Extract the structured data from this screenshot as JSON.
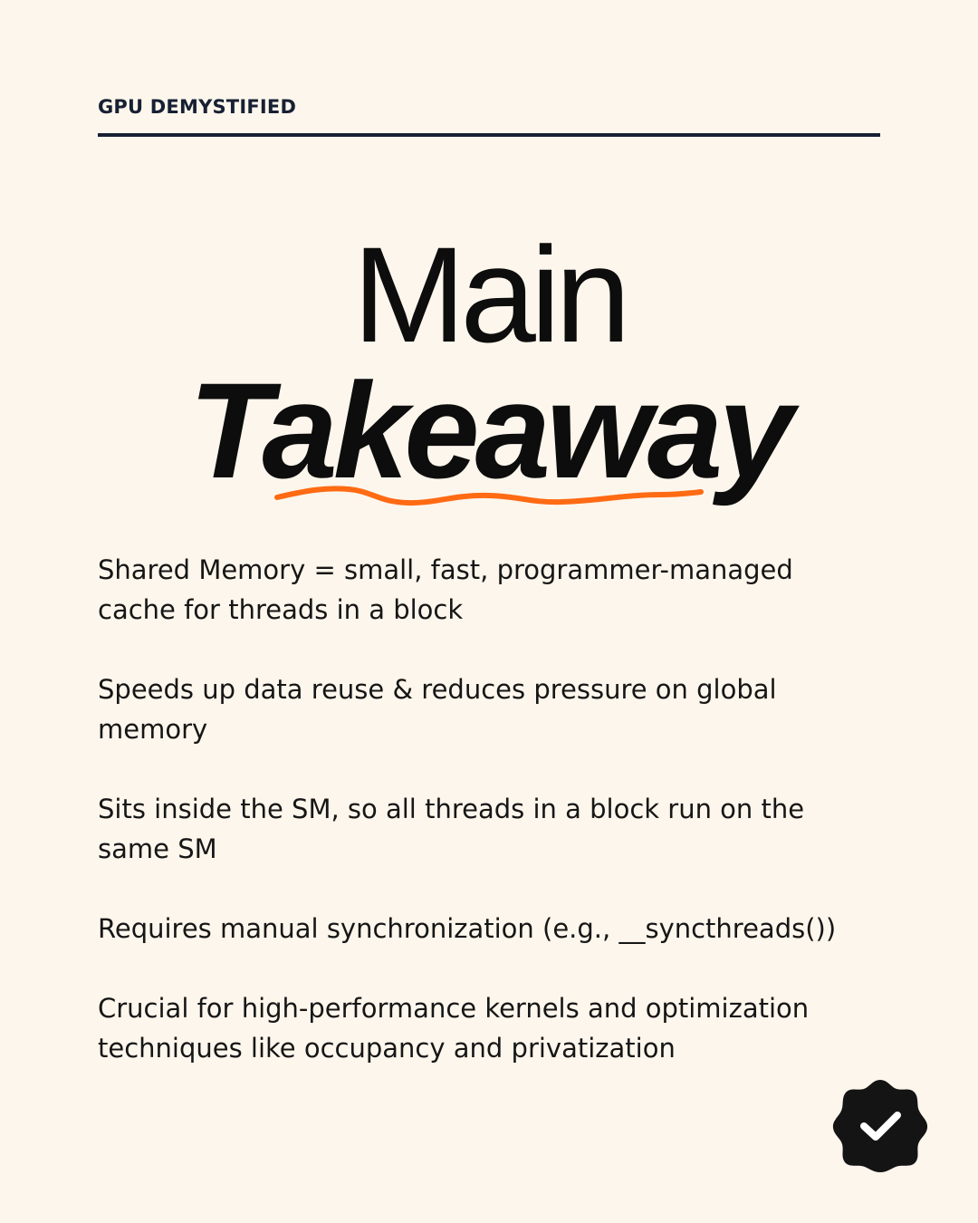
{
  "header": {
    "label": "GPU DEMYSTIFIED"
  },
  "title": {
    "line1": "Main",
    "line2": "Takeaway"
  },
  "colors": {
    "background": "#fdf6ec",
    "accent": "#ff6a13",
    "text": "#141414",
    "rule": "#172033"
  },
  "points": [
    "Shared Memory = small, fast, programmer-managed cache for threads in a block",
    "Speeds up data reuse & reduces pressure on global memory",
    "Sits inside the SM, so all threads in a block run on the same SM",
    "Requires manual synchronization (e.g., __syncthreads())",
    "Crucial for high-performance kernels and optimization techniques like occupancy and privatization"
  ],
  "badge": {
    "icon": "check-badge-icon"
  }
}
